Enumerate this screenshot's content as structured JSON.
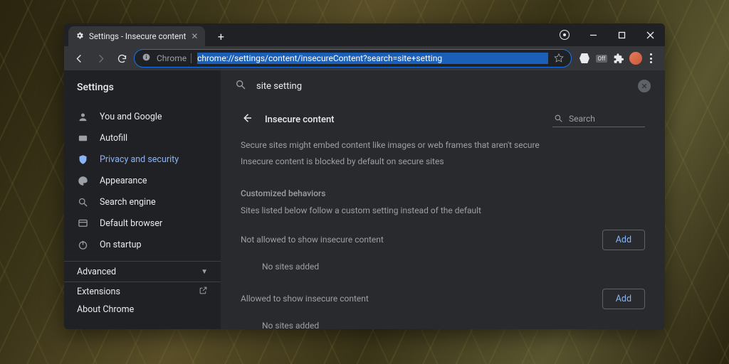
{
  "tab": {
    "title": "Settings - Insecure content"
  },
  "omnibox": {
    "chip": "Chrome",
    "url": "chrome://settings/content/insecureContent?search=site+setting"
  },
  "sidebar": {
    "title": "Settings",
    "items": [
      {
        "label": "You and Google"
      },
      {
        "label": "Autofill"
      },
      {
        "label": "Privacy and security"
      },
      {
        "label": "Appearance"
      },
      {
        "label": "Search engine"
      },
      {
        "label": "Default browser"
      },
      {
        "label": "On startup"
      }
    ],
    "advanced": "Advanced",
    "extensions": "Extensions",
    "about": "About Chrome"
  },
  "search": {
    "value": "site setting"
  },
  "page": {
    "title": "Insecure content",
    "search_placeholder": "Search",
    "desc1": "Secure sites might embed content like images or web frames that aren't secure",
    "desc2": "Insecure content is blocked by default on secure sites",
    "custom_h": "Customized behaviors",
    "custom_d": "Sites listed below follow a custom setting instead of the default",
    "not_allowed": "Not allowed to show insecure content",
    "allowed": "Allowed to show insecure content",
    "add": "Add",
    "empty": "No sites added"
  }
}
